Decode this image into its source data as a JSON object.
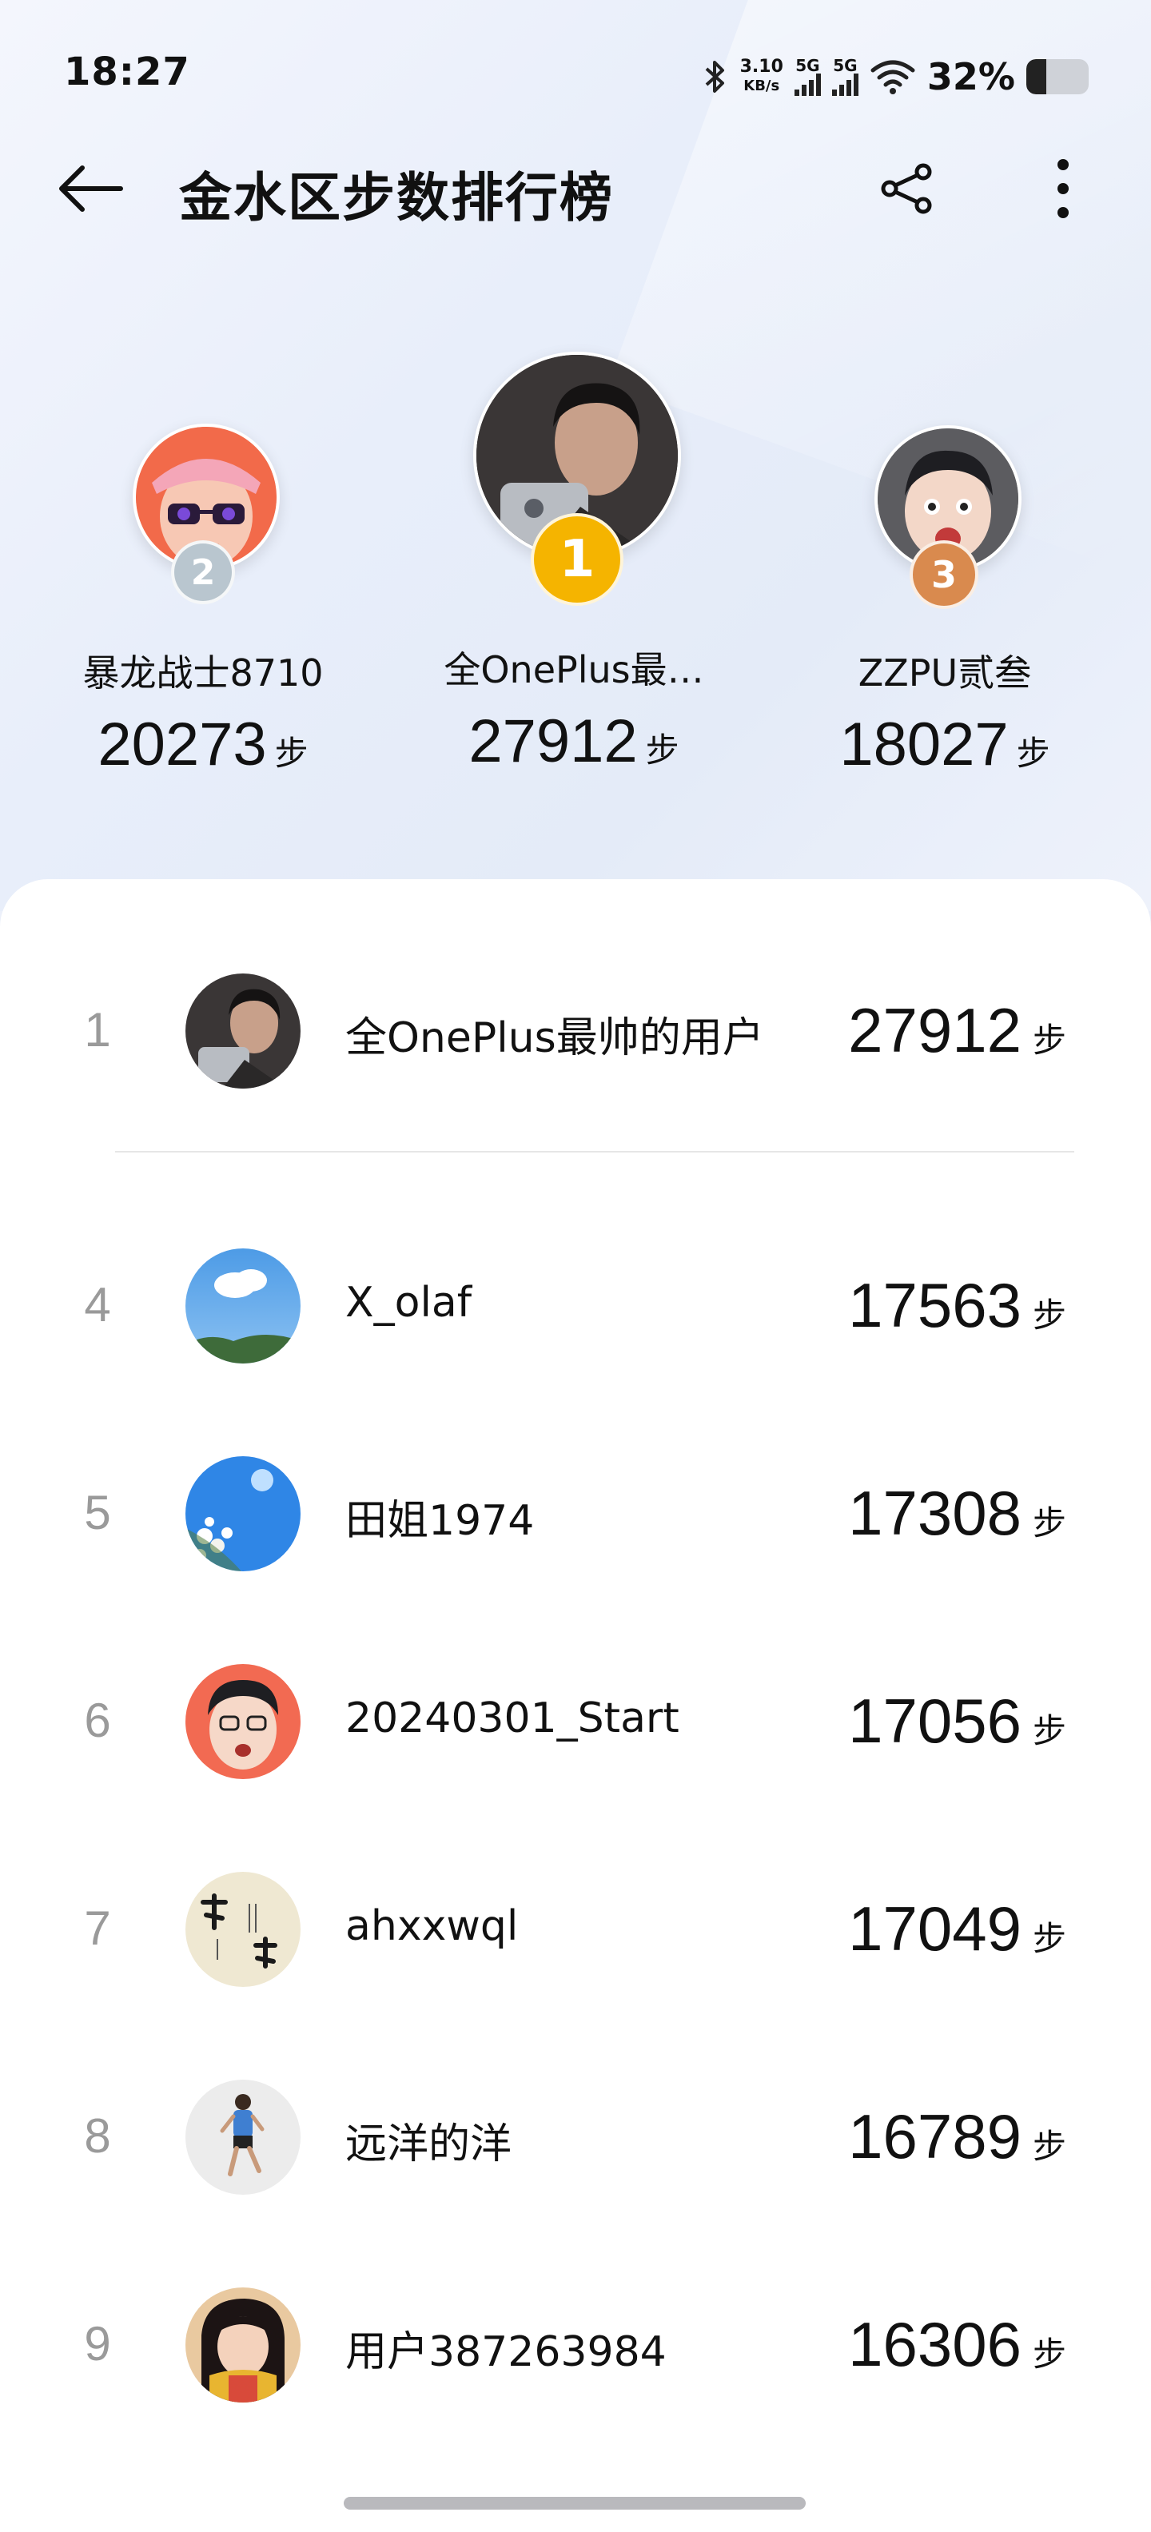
{
  "status": {
    "time": "18:27",
    "net_speed_top": "3.10",
    "net_speed_bottom": "KB/s",
    "sim1": "5G",
    "sim2": "5G",
    "battery_pct": "32%",
    "battery_level": 0.32
  },
  "header": {
    "title": "金水区步数排行榜",
    "back_icon": "arrow-left-icon",
    "share_icon": "share-icon",
    "more_icon": "more-vertical-icon"
  },
  "podium": [
    {
      "rank": "2",
      "name": "暴龙战士8710",
      "steps": "20273",
      "unit": "步",
      "medal_color": "#b9c6cf"
    },
    {
      "rank": "1",
      "name": "全OnePlus最…",
      "steps": "27912",
      "unit": "步",
      "medal_color": "#f5b400"
    },
    {
      "rank": "3",
      "name": "ZZPU贰叁",
      "steps": "18027",
      "unit": "步",
      "medal_color": "#d98a4e"
    }
  ],
  "list": [
    {
      "rank": "1",
      "name": "全OnePlus最帅的用户",
      "steps": "27912",
      "unit": "步"
    },
    {
      "rank": "4",
      "name": "X_olaf",
      "steps": "17563",
      "unit": "步"
    },
    {
      "rank": "5",
      "name": "田姐1974",
      "steps": "17308",
      "unit": "步"
    },
    {
      "rank": "6",
      "name": "20240301_Start",
      "steps": "17056",
      "unit": "步"
    },
    {
      "rank": "7",
      "name": "ahxxwql",
      "steps": "17049",
      "unit": "步"
    },
    {
      "rank": "8",
      "name": "远洋的洋",
      "steps": "16789",
      "unit": "步"
    },
    {
      "rank": "9",
      "name": "用户387263984",
      "steps": "16306",
      "unit": "步"
    }
  ]
}
